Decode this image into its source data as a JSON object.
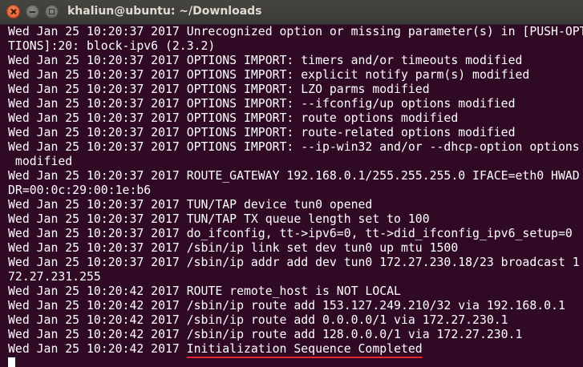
{
  "window": {
    "title": "khaliun@ubuntu: ~/Downloads"
  },
  "terminal": {
    "lines": [
      "Wed Jan 25 10:20:37 2017 Unrecognized option or missing parameter(s) in [PUSH-OPTIONS]:20: block-ipv6 (2.3.2)",
      "TIONS]:20: block-ipv6 (2.3.2)",
      "Wed Jan 25 10:20:37 2017 OPTIONS IMPORT: timers and/or timeouts modified",
      "Wed Jan 25 10:20:37 2017 OPTIONS IMPORT: explicit notify parm(s) modified",
      "Wed Jan 25 10:20:37 2017 OPTIONS IMPORT: LZO parms modified",
      "Wed Jan 25 10:20:37 2017 OPTIONS IMPORT: --ifconfig/up options modified",
      "Wed Jan 25 10:20:37 2017 OPTIONS IMPORT: route options modified",
      "Wed Jan 25 10:20:37 2017 OPTIONS IMPORT: route-related options modified",
      "Wed Jan 25 10:20:37 2017 OPTIONS IMPORT: --ip-win32 and/or --dhcp-option options",
      " modified",
      "Wed Jan 25 10:20:37 2017 ROUTE_GATEWAY 192.168.0.1/255.255.255.0 IFACE=eth0 HWAD",
      "DR=00:0c:29:00:1e:b6",
      "Wed Jan 25 10:20:37 2017 TUN/TAP device tun0 opened",
      "Wed Jan 25 10:20:37 2017 TUN/TAP TX queue length set to 100",
      "Wed Jan 25 10:20:37 2017 do_ifconfig, tt->ipv6=0, tt->did_ifconfig_ipv6_setup=0",
      "Wed Jan 25 10:20:37 2017 /sbin/ip link set dev tun0 up mtu 1500",
      "Wed Jan 25 10:20:37 2017 /sbin/ip addr add dev tun0 172.27.230.18/23 broadcast 1",
      "72.27.231.255",
      "Wed Jan 25 10:20:42 2017 ROUTE remote_host is NOT LOCAL",
      "Wed Jan 25 10:20:42 2017 /sbin/ip route add 153.127.249.210/32 via 192.168.0.1",
      "Wed Jan 25 10:20:42 2017 /sbin/ip route add 0.0.0.0/1 via 172.27.230.1",
      "Wed Jan 25 10:20:42 2017 /sbin/ip route add 128.0.0.0/1 via 172.27.230.1"
    ],
    "last_line_prefix": "Wed Jan 25 10:20:42 2017 ",
    "last_line_highlight": "Initialization Sequence Completed",
    "highlight_color": "#e8252f"
  }
}
